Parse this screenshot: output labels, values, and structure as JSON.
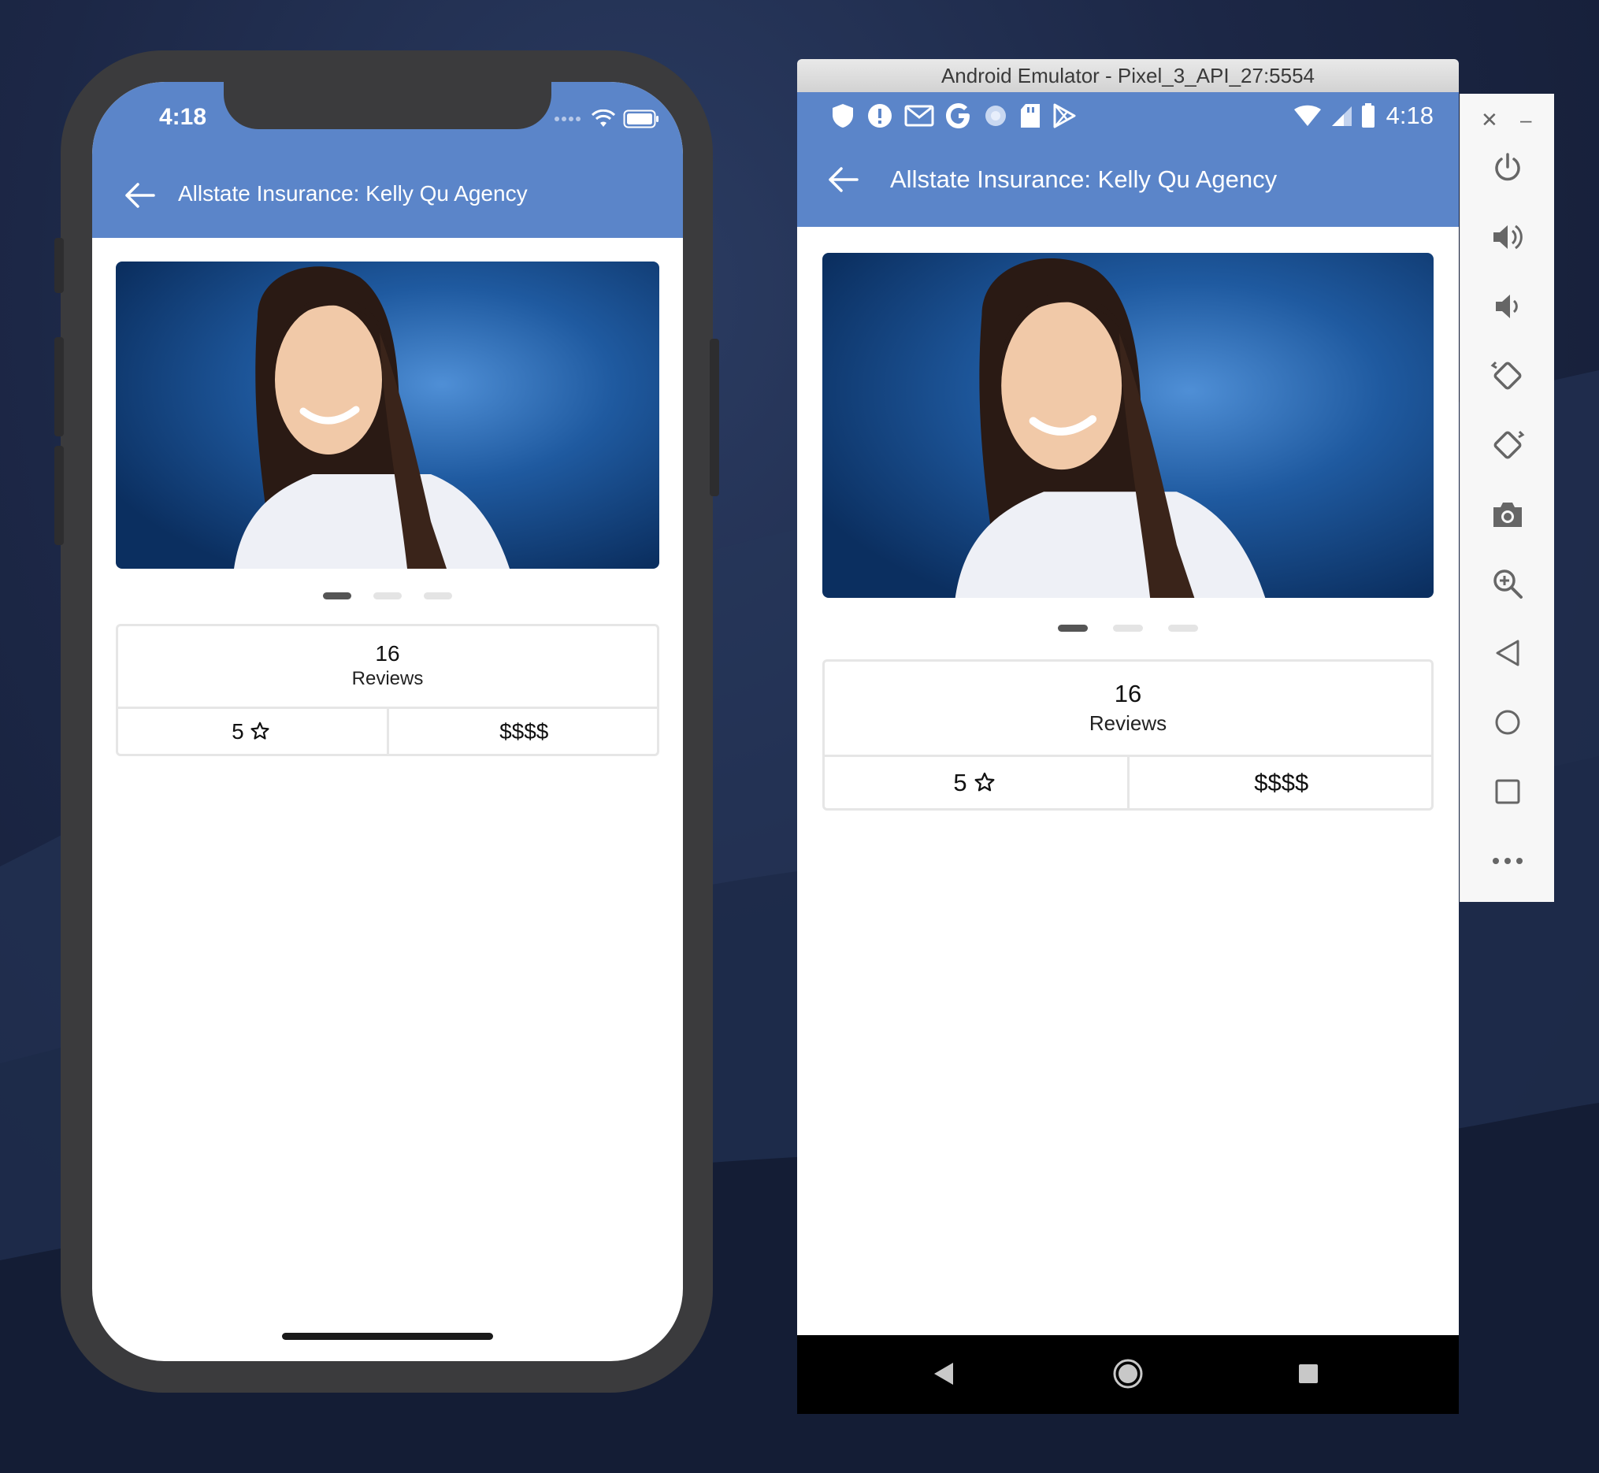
{
  "ios": {
    "status_time": "4:18",
    "header_title": "Allstate Insurance: Kelly Qu Agency",
    "reviews_count": "16",
    "reviews_label": "Reviews",
    "rating": "5",
    "price": "$$$$",
    "carousel": {
      "total": 3,
      "active": 1
    }
  },
  "android": {
    "window_title": "Android Emulator - Pixel_3_API_27:5554",
    "status_time": "4:18",
    "header_title": "Allstate Insurance: Kelly Qu Agency",
    "reviews_count": "16",
    "reviews_label": "Reviews",
    "rating": "5",
    "price": "$$$$",
    "carousel": {
      "total": 3,
      "active": 1
    }
  },
  "emulator_toolbar": {
    "tools": [
      "close-icon",
      "minimize-icon",
      "power-icon",
      "volume-up-icon",
      "volume-down-icon",
      "rotate-left-icon",
      "rotate-right-icon",
      "camera-icon",
      "zoom-icon",
      "back-icon",
      "home-icon",
      "overview-icon",
      "more-icon"
    ]
  },
  "colors": {
    "header_blue": "#5b85c9",
    "desktop_bg": "#1c2746",
    "phone_frame": "#3b3b3d"
  }
}
